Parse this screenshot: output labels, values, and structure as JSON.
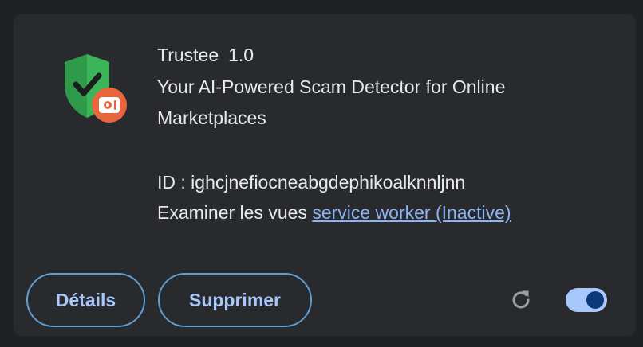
{
  "extension": {
    "name": "Trustee",
    "version": "1.0",
    "description": "Your AI-Powered Scam Detector for Online Marketplaces",
    "id_line": "ID : ighcjnefiocneabgdephikoalknnljnn",
    "views_prefix": "Examiner les vues",
    "views_link": "service worker (Inactive)",
    "enabled": true
  },
  "buttons": {
    "details": "Détails",
    "remove": "Supprimer"
  },
  "icons": {
    "extension": "shield-check-badge-icon",
    "reload": "reload-icon",
    "toggle": "toggle-switch"
  },
  "colors": {
    "background": "#202124",
    "card": "#292a2d",
    "text": "#e8eaed",
    "link": "#8ab4f8",
    "button_border": "#5f9fd3",
    "toggle_track": "#a8c7fa",
    "toggle_knob": "#0b3a7a",
    "shield_green": "#34a853",
    "badge_orange": "#e8663d"
  }
}
